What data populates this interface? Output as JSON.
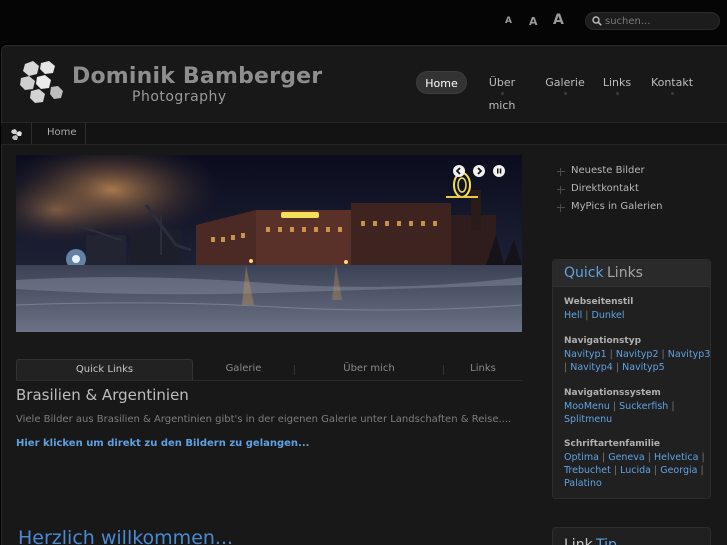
{
  "font_size_controls": [
    "A",
    "A",
    "A"
  ],
  "search": {
    "placeholder": "suchen..."
  },
  "header": {
    "brand_name": "Dominik Bamberger",
    "brand_sub": "Photography"
  },
  "nav": {
    "items": [
      {
        "label": "Home",
        "active": true
      },
      {
        "label": "Über mich"
      },
      {
        "label": "Galerie"
      },
      {
        "label": "Links"
      },
      {
        "label": "Kontakt"
      }
    ]
  },
  "breadcrumb": {
    "home": "Home"
  },
  "tabs": [
    "Quick Links",
    "Galerie",
    "Über mich",
    "Links"
  ],
  "article": {
    "title": "Brasilien & Argentinien",
    "text": "Viele Bilder aus Brasilien & Argentinien gibt's in der eigenen Galerie unter Landschaften & Reise....",
    "link": "Hier klicken um direkt zu den Bildern zu gelangen..."
  },
  "welcome": "Herzlich willkommen...",
  "side_links": [
    "Neueste Bilder",
    "Direktkontakt",
    "MyPics in Galerien"
  ],
  "quick_links": {
    "title_a": "Quick",
    "title_b": "Links",
    "groups": [
      {
        "heading": "Webseitenstil",
        "items": [
          "Hell",
          "Dunkel"
        ]
      },
      {
        "heading": "Navigationstyp",
        "items": [
          "Navityp1",
          "Navityp2",
          "Navityp3",
          "Navityp4",
          "Navityp5"
        ]
      },
      {
        "heading": "Navigationssystem",
        "items": [
          "MooMenu",
          "Suckerfish",
          "Splitmenu"
        ]
      },
      {
        "heading": "Schriftartenfamilie",
        "items": [
          "Optima",
          "Geneva",
          "Helvetica",
          "Trebuchet",
          "Lucida",
          "Georgia",
          "Palatino"
        ]
      }
    ]
  },
  "link_tip": {
    "title_a": "Link",
    "title_b": "Tip"
  },
  "colors": {
    "accent": "#5ea2e3",
    "background": "#181818"
  }
}
